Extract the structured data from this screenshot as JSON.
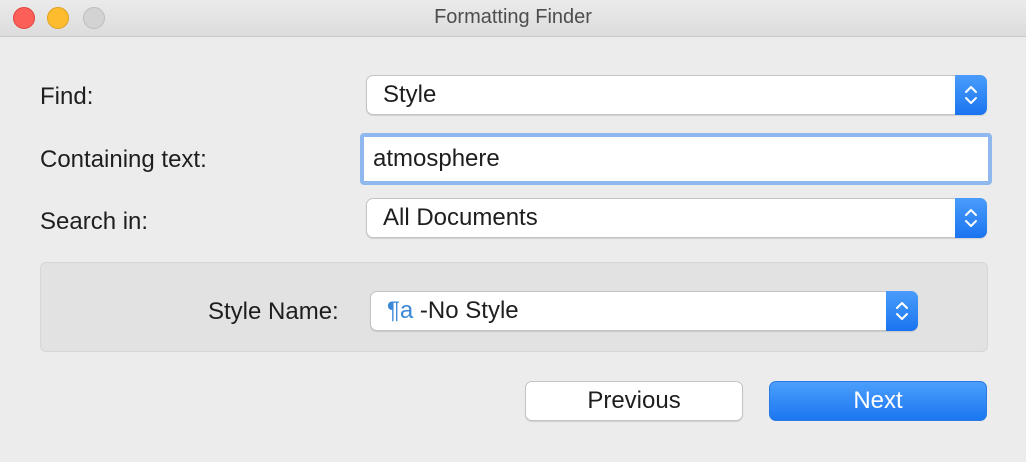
{
  "window": {
    "title": "Formatting Finder"
  },
  "find": {
    "label": "Find:",
    "value": "Style"
  },
  "containing_text": {
    "label": "Containing text:",
    "value": "atmosphere"
  },
  "search_in": {
    "label": "Search in:",
    "value": "All Documents"
  },
  "style_name": {
    "label": "Style Name:",
    "icon_glyph": "¶a",
    "icon": "paragraph-style-icon",
    "value": "-No Style"
  },
  "buttons": {
    "previous": "Previous",
    "next": "Next"
  },
  "colors": {
    "accent": "#1b76f1",
    "focus_ring": "#8fb8ee",
    "close": "#fc5f57",
    "minimize": "#fdbc2e",
    "zoom_disabled": "#d3d3d3"
  }
}
